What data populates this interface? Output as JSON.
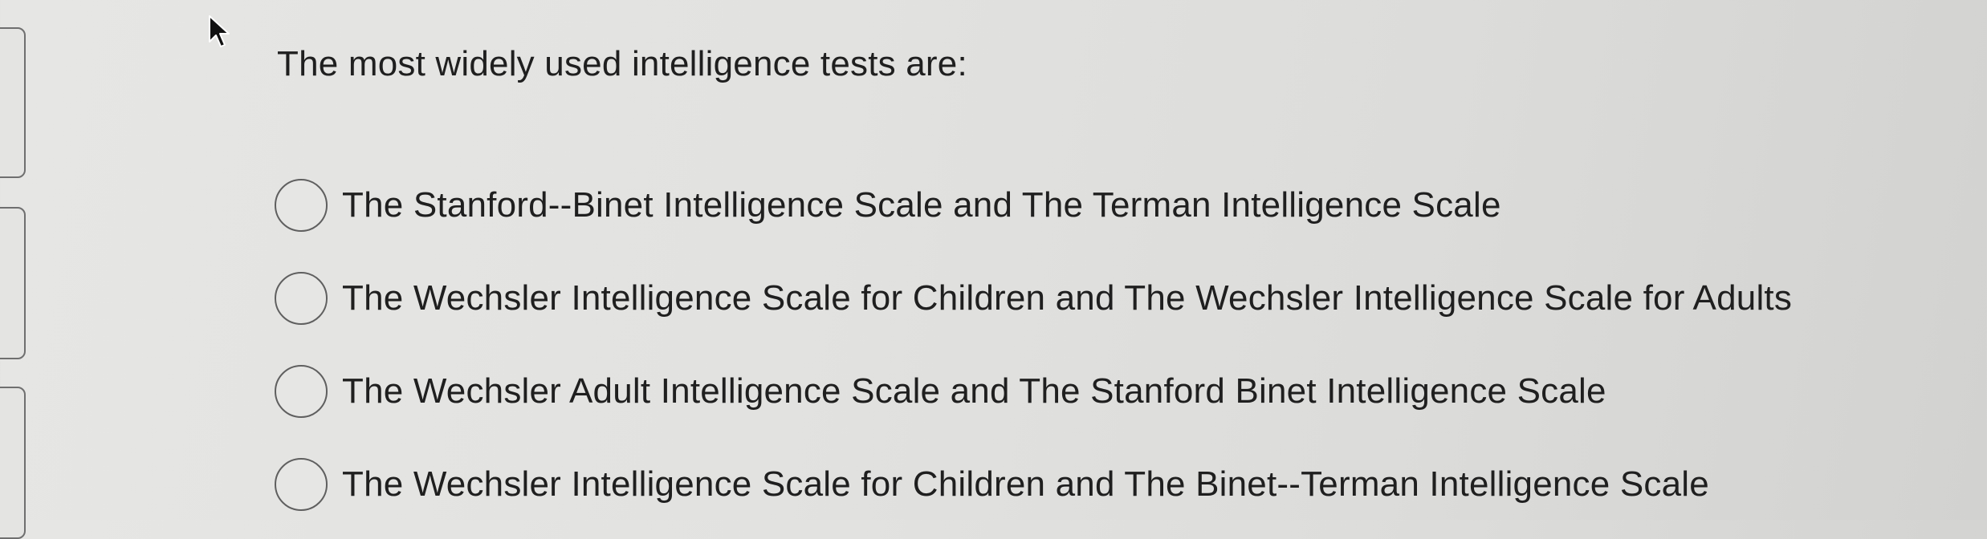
{
  "question": {
    "text": "The most widely used intelligence tests are:"
  },
  "options": [
    {
      "label": "The Stanford--Binet Intelligence Scale and The Terman Intelligence Scale",
      "selected": false
    },
    {
      "label": "The Wechsler Intelligence Scale for Children and The Wechsler Intelligence Scale for Adults",
      "selected": false
    },
    {
      "label": "The Wechsler Adult Intelligence Scale and The Stanford Binet Intelligence Scale",
      "selected": false
    },
    {
      "label": "The Wechsler Intelligence Scale for Children and The Binet--Terman Intelligence Scale",
      "selected": false
    }
  ],
  "icons": {
    "cursor": "mouse-pointer-icon",
    "radio": "radio-button-icon"
  },
  "colors": {
    "background": "#e2e2e0",
    "text": "#1f1f1f",
    "radio_border": "#5f5f5f"
  }
}
